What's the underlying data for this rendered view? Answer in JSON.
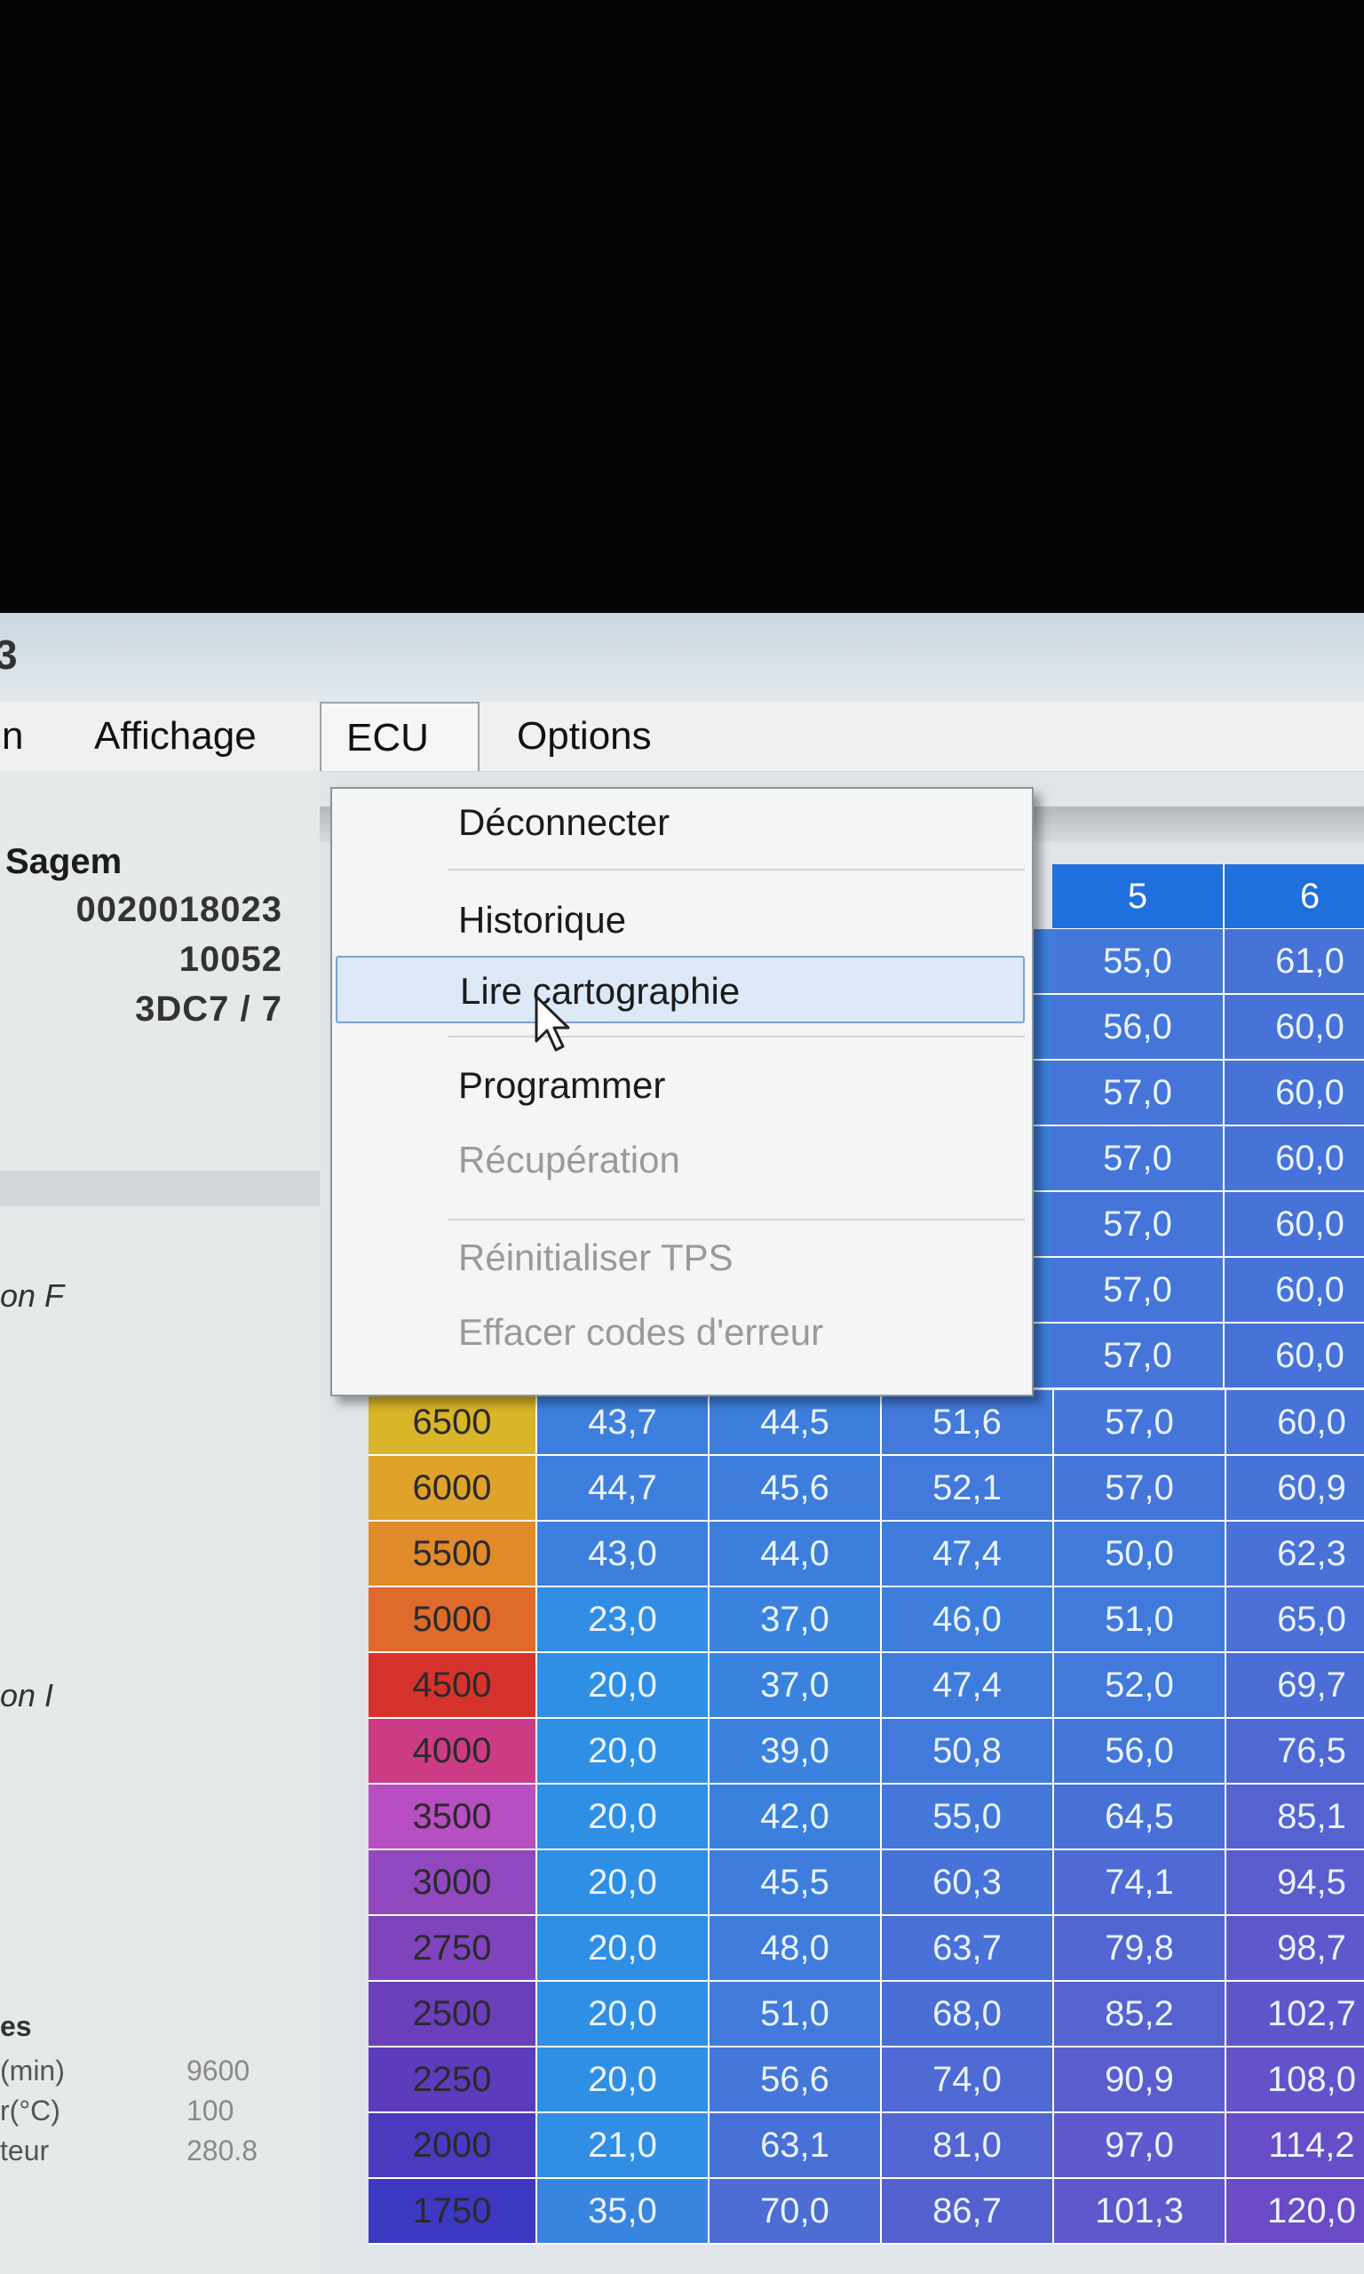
{
  "menu": [
    "n",
    "Affichage",
    "ECU",
    "Options"
  ],
  "ecu_menu": {
    "items": [
      {
        "label": "Déconnecter",
        "enabled": true
      },
      {
        "label": "Historique",
        "enabled": true
      },
      {
        "label": "Lire cartographie",
        "enabled": true,
        "highlighted": true
      },
      {
        "label": "Programmer",
        "enabled": true
      },
      {
        "label": "Récupération",
        "enabled": false
      },
      {
        "label": "Réinitialiser TPS",
        "enabled": false
      },
      {
        "label": "Effacer codes d'erreur",
        "enabled": false
      }
    ]
  },
  "ecu_info": {
    "title": "Sagem",
    "values": [
      "0020018023",
      "10052",
      "3DC7 / 7"
    ]
  },
  "side_labels": [
    "on F",
    "on I",
    "es"
  ],
  "bottom_params": [
    {
      "label": "(min)",
      "value": "9600"
    },
    {
      "label": "r(°C)",
      "value": "100"
    },
    {
      "label": "teur",
      "value": "280.8"
    }
  ],
  "table": {
    "column_headers": [
      "5",
      "6"
    ],
    "upper_rows": [
      [
        "55,0",
        "61,0"
      ],
      [
        "56,0",
        "60,0"
      ],
      [
        "57,0",
        "60,0"
      ],
      [
        "57,0",
        "60,0"
      ],
      [
        "57,0",
        "60,0"
      ],
      [
        "57,0",
        "60,0"
      ],
      [
        "57,0",
        "60,0"
      ]
    ],
    "rows": [
      {
        "rpm": "6500",
        "values": [
          "43,7",
          "44,5",
          "51,6",
          "57,0",
          "60,0"
        ]
      },
      {
        "rpm": "6000",
        "values": [
          "44,7",
          "45,6",
          "52,1",
          "57,0",
          "60,9"
        ]
      },
      {
        "rpm": "5500",
        "values": [
          "43,0",
          "44,0",
          "47,4",
          "50,0",
          "62,3"
        ]
      },
      {
        "rpm": "5000",
        "values": [
          "23,0",
          "37,0",
          "46,0",
          "51,0",
          "65,0"
        ]
      },
      {
        "rpm": "4500",
        "values": [
          "20,0",
          "37,0",
          "47,4",
          "52,0",
          "69,7"
        ]
      },
      {
        "rpm": "4000",
        "values": [
          "20,0",
          "39,0",
          "50,8",
          "56,0",
          "76,5"
        ]
      },
      {
        "rpm": "3500",
        "values": [
          "20,0",
          "42,0",
          "55,0",
          "64,5",
          "85,1"
        ]
      },
      {
        "rpm": "3000",
        "values": [
          "20,0",
          "45,5",
          "60,3",
          "74,1",
          "94,5"
        ]
      },
      {
        "rpm": "2750",
        "values": [
          "20,0",
          "48,0",
          "63,7",
          "79,8",
          "98,7"
        ]
      },
      {
        "rpm": "2500",
        "values": [
          "20,0",
          "51,0",
          "68,0",
          "85,2",
          "102,7"
        ]
      },
      {
        "rpm": "2250",
        "values": [
          "20,0",
          "56,6",
          "74,0",
          "90,9",
          "108,0"
        ]
      },
      {
        "rpm": "2000",
        "values": [
          "21,0",
          "63,1",
          "81,0",
          "97,0",
          "114,2"
        ]
      },
      {
        "rpm": "1750",
        "values": [
          "35,0",
          "70,0",
          "86,7",
          "101,3",
          "120,0"
        ]
      }
    ],
    "rpm_colors": [
      "#d9b52a",
      "#dfa22a",
      "#e08a2a",
      "#df6a2c",
      "#d6322c",
      "#cc3c86",
      "#b74ec2",
      "#9148bf",
      "#7f44bd",
      "#6b3ebc",
      "#5c3cbd",
      "#4a3ac0",
      "#3c38c2"
    ]
  },
  "colors": {
    "header_blue": "#1f6fdc",
    "cell_light": "#2f8fe4",
    "cell_dark": "#6a4ac6",
    "menu_highlight": "#dde9f6"
  }
}
